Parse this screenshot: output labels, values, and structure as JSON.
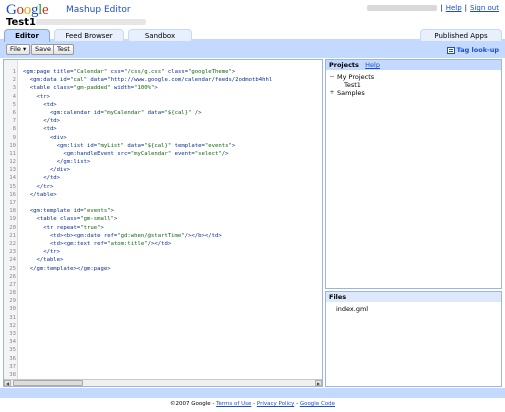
{
  "header": {
    "logo_parts": [
      "G",
      "o",
      "o",
      "g",
      "l",
      "e"
    ],
    "product": "Mashup Editor",
    "project_title": "Test1",
    "help": "Help",
    "signout": "Sign out",
    "separator": "|"
  },
  "tabs": [
    "Editor",
    "Feed Browser",
    "Sandbox",
    "Published Apps"
  ],
  "toolbar": {
    "file": "File ▾",
    "save": "Save",
    "test": "Test",
    "tag_lookup": "Tag look-up"
  },
  "code_lines": [
    "<gm:page title=\"Calendar\" css=\"/css/g.css\" class=\"googleTheme\">",
    "  <gm:data id=\"cal\" data=\"http://www.google.com/calendar/feeds/2odmotb4hhl",
    "  <table class=\"gm-padded\" width=\"100%\">",
    "    <tr>",
    "      <td>",
    "        <gm:calendar id=\"myCalendar\" data=\"${cal}\" />",
    "      </td>",
    "      <td>",
    "        <div>",
    "          <gm:list id=\"myList\" data=\"${cal}\" template=\"events\">",
    "            <gm:handleEvent src=\"myCalendar\" event=\"select\"/>",
    "          </gm:list>",
    "        </div>",
    "      </td>",
    "    </tr>",
    "  </table>",
    "",
    "  <gm:template id=\"events\">",
    "    <table class=\"gm-small\">",
    "      <tr repeat=\"true\">",
    "        <td><b><gm:date ref=\"gd:when/@startTime\"/></b></td>",
    "        <td><gm:text ref=\"atom:title\"/></td>",
    "      </tr>",
    "    </table>",
    "  </gm:template></gm:page>",
    "",
    "",
    "",
    "",
    "",
    "",
    "",
    "",
    "",
    "",
    "",
    "",
    ""
  ],
  "projects_panel": {
    "title": "Projects",
    "help": "Help",
    "my_projects": "My Projects",
    "my_projects_toggle": "−",
    "project_item": "Test1",
    "samples": "Samples",
    "samples_toggle": "+"
  },
  "files_panel": {
    "title": "Files",
    "file": "index.gml"
  },
  "footer": {
    "copyright": "©2007 Google - ",
    "terms": "Terms of Use",
    "sep1": " - ",
    "privacy": "Privacy Policy",
    "sep2": " - ",
    "google_code": "Google Code"
  },
  "colors": {
    "accent": "#c3d9ff",
    "link": "#1a4fc9",
    "code_tag": "#0b2f91",
    "code_string": "#116611"
  }
}
